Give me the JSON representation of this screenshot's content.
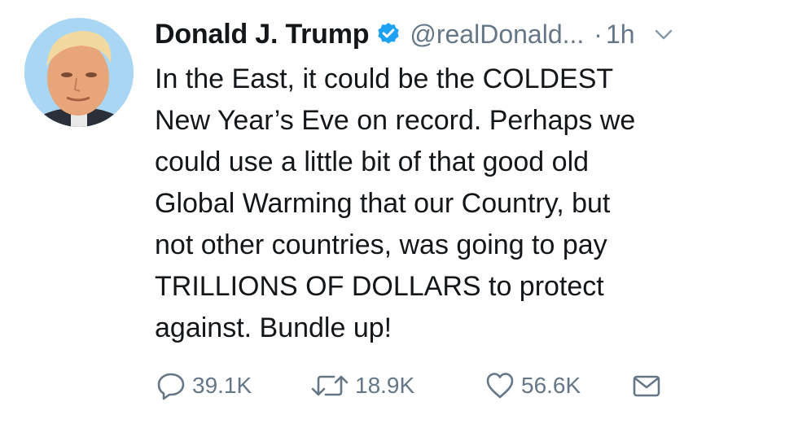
{
  "tweet": {
    "author": {
      "display_name": "Donald J. Trump",
      "handle": "@realDonald...",
      "verified_icon": "verified-badge-icon"
    },
    "separator": "·",
    "time": "1h",
    "menu_icon": "chevron-down-icon",
    "text_lines": [
      "In the East, it could be the COLDEST",
      "New Year’s Eve on record. Perhaps we",
      "could use a little bit of that good old",
      "Global Warming that our Country, but",
      "not other countries, was going to pay",
      "TRILLIONS OF DOLLARS to protect",
      "against. Bundle up!"
    ],
    "actions": {
      "reply": {
        "icon": "reply-icon",
        "count": "39.1K"
      },
      "retweet": {
        "icon": "retweet-icon",
        "count": "18.9K"
      },
      "like": {
        "icon": "heart-icon",
        "count": "56.6K"
      },
      "dm": {
        "icon": "envelope-icon"
      }
    }
  },
  "colors": {
    "text": "#14171a",
    "secondary": "#657786",
    "verified": "#1da1f2",
    "avatar_bg": "#9fd0f2"
  }
}
